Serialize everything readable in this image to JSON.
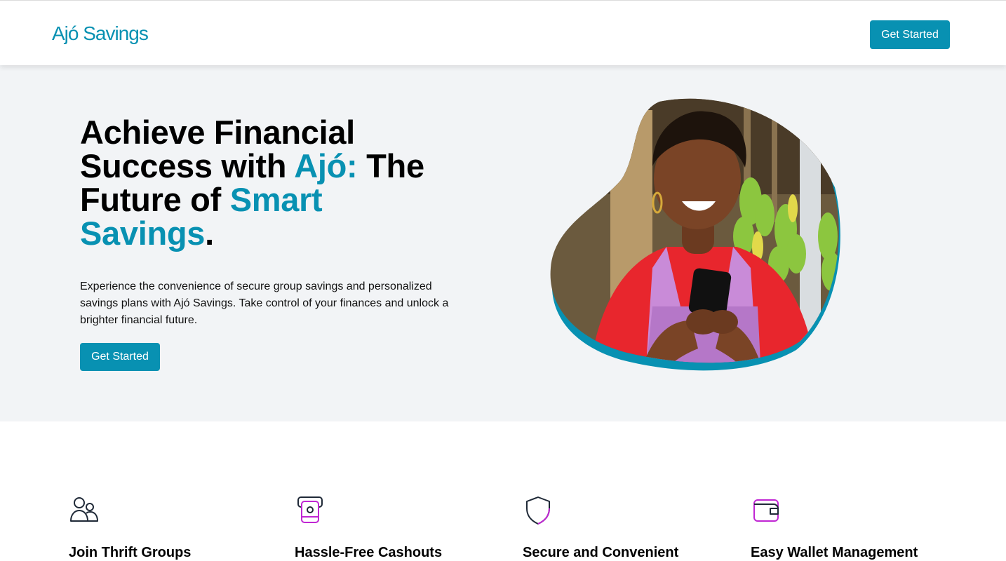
{
  "nav": {
    "logo": "Ajó Savings",
    "cta": "Get Started"
  },
  "hero": {
    "title_line1": "Achieve Financial",
    "title_line2_a": "Success with ",
    "title_line2_accent": "Ajó:",
    "title_line2_b": " The",
    "title_line3_a": "Future of ",
    "title_line3_accent": "Smart",
    "title_line4_accent": "Savings",
    "title_line4_b": ".",
    "description": "Experience the convenience of secure group savings and personalized savings plans with Ajó Savings. Take control of your finances and unlock a brighter financial future.",
    "cta": "Get Started",
    "image_alt": "Smiling woman in red shirt and purple apron using a smartphone at a market stall with bananas"
  },
  "features": [
    {
      "icon": "users-icon",
      "title": "Join Thrift Groups"
    },
    {
      "icon": "cashout-icon",
      "title": "Hassle-Free Cashouts"
    },
    {
      "icon": "shield-icon",
      "title": "Secure and Convenient"
    },
    {
      "icon": "wallet-icon",
      "title": "Easy Wallet Management"
    }
  ],
  "colors": {
    "brand": "#0891b2",
    "hero_background": "#f2f4f6",
    "icon_accent": "#c026d3"
  }
}
